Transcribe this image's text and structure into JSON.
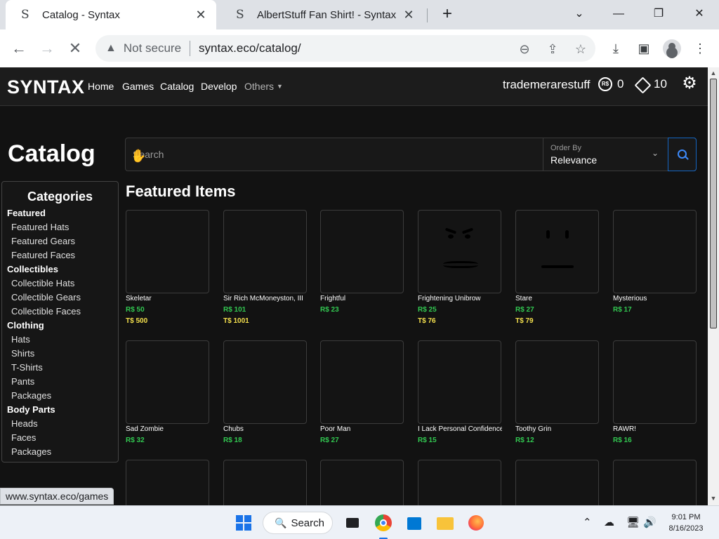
{
  "browser": {
    "tabs": [
      {
        "title": "Catalog - Syntax",
        "favicon": "S"
      },
      {
        "title": "AlbertStuff Fan Shirt! - Syntax",
        "favicon": "S"
      }
    ],
    "address": {
      "security": "Not secure",
      "url": "syntax.eco/catalog/"
    },
    "status_url": "www.syntax.eco/games"
  },
  "site": {
    "brand": "SYNTAX",
    "nav": {
      "home": "Home",
      "games": "Games",
      "catalog": "Catalog",
      "develop": "Develop",
      "others": "Others"
    },
    "username": "trademerarestuff",
    "robux_icon_text": "R$",
    "robux": "0",
    "tickets": "10"
  },
  "catalog": {
    "title": "Catalog",
    "search_placeholder": "Search",
    "order_by_label": "Order By",
    "order_by_value": "Relevance",
    "categories_title": "Categories",
    "categories": [
      {
        "label": "Featured",
        "type": "head"
      },
      {
        "label": "Featured Hats",
        "type": "sub"
      },
      {
        "label": "Featured Gears",
        "type": "sub"
      },
      {
        "label": "Featured Faces",
        "type": "sub"
      },
      {
        "label": "Collectibles",
        "type": "head"
      },
      {
        "label": "Collectible Hats",
        "type": "sub"
      },
      {
        "label": "Collectible Gears",
        "type": "sub"
      },
      {
        "label": "Collectible Faces",
        "type": "sub"
      },
      {
        "label": "Clothing",
        "type": "head"
      },
      {
        "label": "Hats",
        "type": "sub"
      },
      {
        "label": "Shirts",
        "type": "sub"
      },
      {
        "label": "T-Shirts",
        "type": "sub"
      },
      {
        "label": "Pants",
        "type": "sub"
      },
      {
        "label": "Packages",
        "type": "sub"
      },
      {
        "label": "Body Parts",
        "type": "head"
      },
      {
        "label": "Heads",
        "type": "sub"
      },
      {
        "label": "Faces",
        "type": "sub"
      },
      {
        "label": "Packages",
        "type": "sub"
      }
    ],
    "featured_title": "Featured Items",
    "items": [
      {
        "name": "Skeletar",
        "robux": "R$ 50",
        "tix": "T$ 500",
        "face": "none"
      },
      {
        "name": "Sir Rich McMoneyston, III",
        "robux": "R$ 101",
        "tix": "T$ 1001",
        "face": "none"
      },
      {
        "name": "Frightful",
        "robux": "R$ 23",
        "tix": "",
        "face": "none"
      },
      {
        "name": "Frightening Unibrow",
        "robux": "R$ 25",
        "tix": "T$ 76",
        "face": "angry"
      },
      {
        "name": "Stare",
        "robux": "R$ 27",
        "tix": "T$ 79",
        "face": "stare"
      },
      {
        "name": "Mysterious",
        "robux": "R$ 17",
        "tix": "",
        "face": "none"
      },
      {
        "name": "Sad Zombie",
        "robux": "R$ 32",
        "tix": "",
        "face": "none"
      },
      {
        "name": "Chubs",
        "robux": "R$ 18",
        "tix": "",
        "face": "none"
      },
      {
        "name": "Poor Man",
        "robux": "R$ 27",
        "tix": "",
        "face": "none"
      },
      {
        "name": "I Lack Personal Confidence",
        "robux": "R$ 15",
        "tix": "",
        "face": "none"
      },
      {
        "name": "Toothy Grin",
        "robux": "R$ 12",
        "tix": "",
        "face": "none"
      },
      {
        "name": "RAWR!",
        "robux": "R$ 16",
        "tix": "",
        "face": "none"
      },
      {
        "name": "",
        "robux": "",
        "tix": "",
        "face": "none"
      },
      {
        "name": "",
        "robux": "",
        "tix": "",
        "face": "none"
      },
      {
        "name": "",
        "robux": "",
        "tix": "",
        "face": "none"
      },
      {
        "name": "",
        "robux": "",
        "tix": "",
        "face": "none"
      },
      {
        "name": "",
        "robux": "",
        "tix": "",
        "face": "none"
      },
      {
        "name": "",
        "robux": "",
        "tix": "",
        "face": "none"
      }
    ]
  },
  "taskbar": {
    "search_label": "Search",
    "time": "9:01 PM",
    "date": "8/16/2023"
  },
  "colors": {
    "robux_price": "#32c851",
    "tix_price": "#f4e04d",
    "search_accent": "#3d8bfd"
  }
}
